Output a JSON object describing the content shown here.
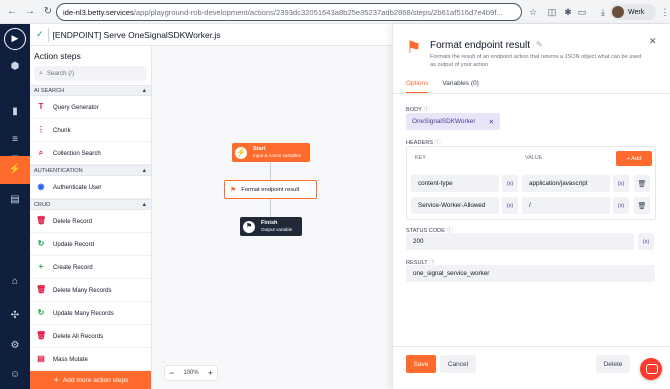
{
  "browser": {
    "url_host": "ide-nl3.betty.services",
    "url_path": "/app/playground-rob-development/actions/2393dc32051643a8b25e35237adb2868/steps/2b61af516d7e4b9f...",
    "profile_name": "Werk"
  },
  "header": {
    "title": "[ENDPOINT] Serve OneSignalSDKWorker.js"
  },
  "steps": {
    "title": "Action steps",
    "search_placeholder": "Search (/)",
    "sections": [
      {
        "label": "AI search",
        "items": [
          {
            "label": "Query Generator",
            "icon": "query-generator-icon",
            "color": "#e11d48"
          },
          {
            "label": "Chunk",
            "icon": "chunk-icon",
            "color": "#e11d48"
          },
          {
            "label": "Collection Search",
            "icon": "collection-search-icon",
            "color": "#e11d48"
          }
        ]
      },
      {
        "label": "Authentication",
        "items": [
          {
            "label": "Authenticate User",
            "icon": "authenticate-user-icon",
            "color": "#2563eb"
          }
        ]
      },
      {
        "label": "CRUD",
        "items": [
          {
            "label": "Delete Record",
            "icon": "trash-icon",
            "color": "#e11d48"
          },
          {
            "label": "Update Record",
            "icon": "refresh-icon",
            "color": "#16a34a"
          },
          {
            "label": "Create Record",
            "icon": "plus-icon",
            "color": "#16a34a"
          },
          {
            "label": "Delete Many Records",
            "icon": "trash-icon",
            "color": "#e11d48"
          },
          {
            "label": "Update Many Records",
            "icon": "refresh-icon",
            "color": "#16a34a"
          },
          {
            "label": "Delete All Records",
            "icon": "trash-icon",
            "color": "#e11d48"
          },
          {
            "label": "Mass Mutate",
            "icon": "mass-mutate-icon",
            "color": "#e11d48"
          }
        ]
      }
    ],
    "add_label": "Add more action steps"
  },
  "canvas": {
    "start": {
      "title": "Start",
      "subtitle": "Input & Action variables"
    },
    "step": {
      "label": "Format endpoint result"
    },
    "finish": {
      "title": "Finish",
      "subtitle": "Output variable"
    },
    "zoom": "100%"
  },
  "panel": {
    "title": "Format endpoint result",
    "description": "Formats the result of an endpoint action that returns a JSON object what can be used as output of your action",
    "tabs": [
      "Options",
      "Variables (0)"
    ],
    "body_label": "Body",
    "body_value": "OneSignalSDKWorker",
    "headers_label": "Headers",
    "key_col": "Key",
    "value_col": "Value",
    "add_label": "+ Add",
    "headers": [
      {
        "key": "content-type",
        "value": "application/javascript"
      },
      {
        "key": "Service-Worker-Allowed",
        "value": "/"
      }
    ],
    "var_label": "(x)",
    "status_label": "Status code",
    "status_value": "200",
    "result_label": "Result",
    "result_value": "one_signal_service_worker",
    "save": "Save",
    "cancel": "Cancel",
    "delete": "Delete"
  },
  "colors": {
    "accent": "#ff6b2c",
    "rail": "#0f1f3d",
    "chip": "#e9e4f7"
  }
}
